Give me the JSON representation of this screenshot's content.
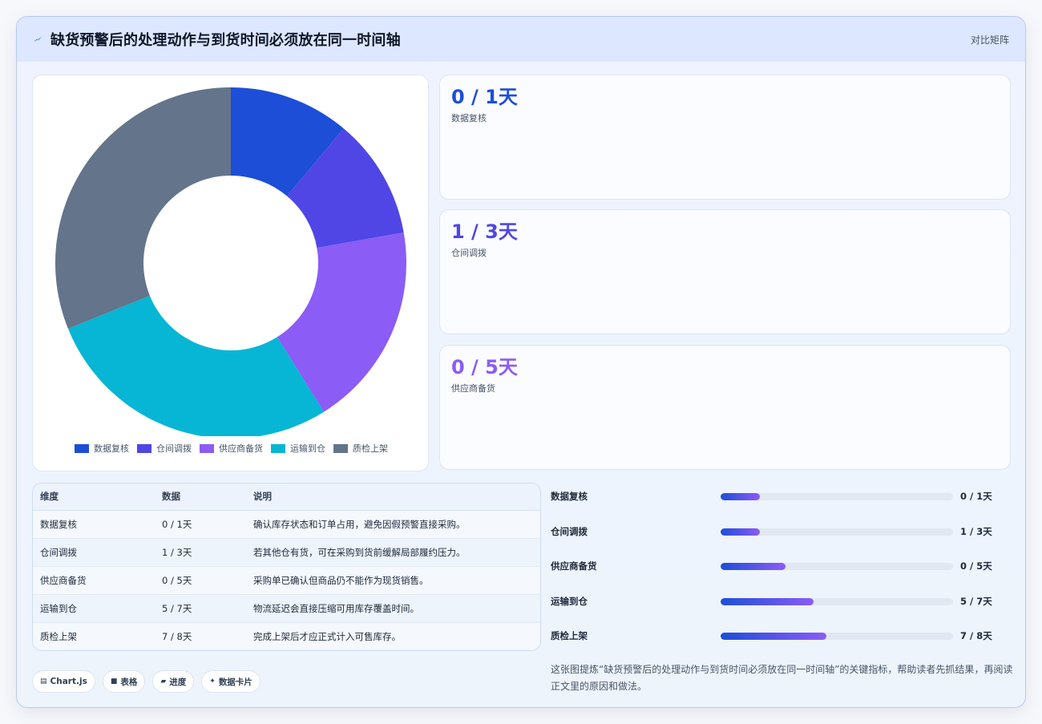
{
  "header": {
    "title": "缺货预警后的处理动作与到货时间必须放在同一时间轴",
    "link": "对比矩阵"
  },
  "chart_data": {
    "type": "pie",
    "categories": [
      "数据复核",
      "仓间调拨",
      "供应商备货",
      "运输到仓",
      "质检上架"
    ],
    "values": [
      1,
      1,
      1.7,
      2.5,
      2.8
    ],
    "colors": [
      "#1d4ed8",
      "#4f46e5",
      "#8b5cf6",
      "#06b6d4",
      "#64748b"
    ],
    "legend_position": "bottom"
  },
  "stats": [
    {
      "value": "0 / 1天",
      "label": "数据复核",
      "color": "#1d4ed8"
    },
    {
      "value": "1 / 3天",
      "label": "仓间调拨",
      "color": "#4f46e5"
    },
    {
      "value": "0 / 5天",
      "label": "供应商备货",
      "color": "#8b5cf6"
    }
  ],
  "table": {
    "headers": [
      "维度",
      "数据",
      "说明"
    ],
    "rows": [
      [
        "数据复核",
        "0 / 1天",
        "确认库存状态和订单占用，避免因假预警直接采购。"
      ],
      [
        "仓间调拨",
        "1 / 3天",
        "若其他仓有货，可在采购到货前缓解局部履约压力。"
      ],
      [
        "供应商备货",
        "0 / 5天",
        "采购单已确认但商品仍不能作为现货销售。"
      ],
      [
        "运输到仓",
        "5 / 7天",
        "物流延迟会直接压缩可用库存覆盖时间。"
      ],
      [
        "质检上架",
        "7 / 8天",
        "完成上架后才应正式计入可售库存。"
      ]
    ]
  },
  "progress": [
    {
      "label": "数据复核",
      "value": "0 / 1天",
      "fill": 0.17
    },
    {
      "label": "仓间调拨",
      "value": "1 / 3天",
      "fill": 0.17
    },
    {
      "label": "供应商备货",
      "value": "0 / 5天",
      "fill": 0.28
    },
    {
      "label": "运输到仓",
      "value": "5 / 7天",
      "fill": 0.4
    },
    {
      "label": "质检上架",
      "value": "7 / 8天",
      "fill": 0.455
    }
  ],
  "chips": [
    {
      "icon": "▤",
      "label": "Chart.js",
      "icon_name": "chart-icon"
    },
    {
      "icon": "■",
      "label": "表格",
      "icon_name": "table-icon"
    },
    {
      "icon": "▰",
      "label": "进度",
      "icon_name": "progress-icon"
    },
    {
      "icon": "✦",
      "label": "数据卡片",
      "icon_name": "sparkle-icon"
    }
  ],
  "note": "这张图提炼“缺货预警后的处理动作与到货时间必须放在同一时间轴”的关键指标，帮助读者先抓结果，再阅读正文里的原因和做法。"
}
